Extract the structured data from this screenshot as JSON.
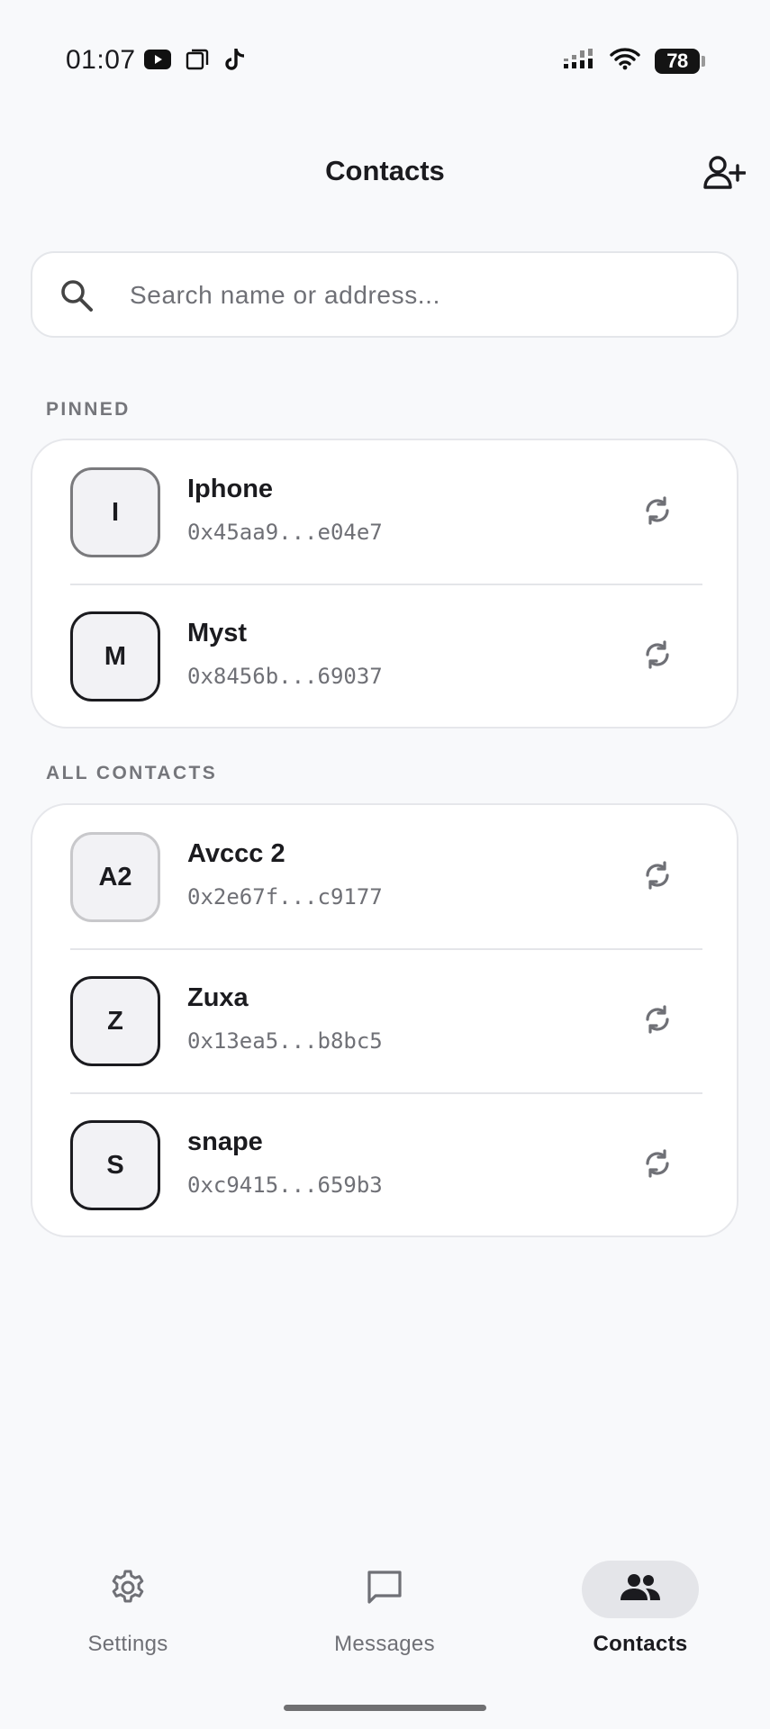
{
  "status_bar": {
    "time": "01:07",
    "app_icons": [
      "youtube-icon",
      "copy-icon",
      "tiktok-icon"
    ],
    "battery_level": "78",
    "signal": "signal-icon",
    "wifi": "wifi-icon"
  },
  "header": {
    "title": "Contacts",
    "add_contact_icon": "add-person-icon"
  },
  "search": {
    "placeholder": "Search name or address...",
    "value": ""
  },
  "sections": {
    "pinned_label": "PINNED",
    "all_label": "ALL CONTACTS"
  },
  "pinned": [
    {
      "initials": "I",
      "name": "Iphone",
      "address": "0x45aa9...e04e7"
    },
    {
      "initials": "M",
      "name": "Myst",
      "address": "0x8456b...69037"
    }
  ],
  "contacts": [
    {
      "initials": "A2",
      "name": "Avccc 2",
      "address": "0x2e67f...c9177"
    },
    {
      "initials": "Z",
      "name": "Zuxa",
      "address": "0x13ea5...b8bc5"
    },
    {
      "initials": "S",
      "name": "snape",
      "address": "0xc9415...659b3"
    }
  ],
  "nav": {
    "settings": "Settings",
    "messages": "Messages",
    "contacts": "Contacts",
    "active": "contacts"
  },
  "colors": {
    "background": "#f8f9fb",
    "card": "#ffffff",
    "text": "#1b1b1f",
    "muted": "#6f7076",
    "active_pill": "#e4e5e9"
  }
}
